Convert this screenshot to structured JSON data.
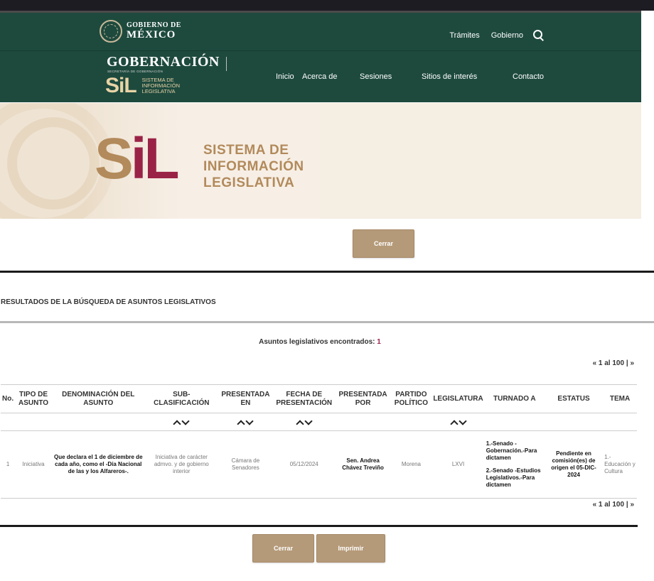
{
  "gov": {
    "logo_line1": "GOBIERNO DE",
    "logo_line2": "MÉXICO",
    "nav": [
      "Trámites",
      "Gobierno"
    ]
  },
  "sil_header": {
    "gobernacion": "GOBERNACIÓN",
    "gobernacion_sub": "SECRETARÍA DE GOBERNACIÓN",
    "sil_letters": "SiL",
    "sil_label_lines": [
      "SISTEMA DE",
      "INFORMACIÓN",
      "LEGISLATIVA"
    ],
    "nav": [
      "Inicio",
      "Acerca de",
      "Sesiones",
      "Sitios de interés",
      "Contacto"
    ]
  },
  "banner": {
    "sil_s": "S",
    "sil_i": "i",
    "sil_l": "L",
    "label_lines": [
      "SISTEMA DE",
      "INFORMACIÓN",
      "LEGISLATIVA"
    ]
  },
  "buttons": {
    "close_top": "Cerrar",
    "close_bottom": "Cerrar",
    "print": "Imprimir"
  },
  "results": {
    "title": "RESULTADOS DE LA BÚSQUEDA DE ASUNTOS LEGISLATIVOS",
    "found_label": "Asuntos legislativos encontrados:",
    "found_count": "1",
    "pager": {
      "prev": "«",
      "range": "1 al 100",
      "sep": "|",
      "next": "»"
    },
    "columns": [
      "No.",
      "TIPO DE ASUNTO",
      "DENOMINACIÓN DEL ASUNTO",
      "SUB-CLASIFICACIÓN",
      "PRESENTADA EN",
      "FECHA DE PRESENTACIÓN",
      "PRESENTADA POR",
      "PARTIDO POLÍTICO",
      "LEGISLATURA",
      "TURNADO A",
      "ESTATUS",
      "TEMA"
    ],
    "rows": [
      {
        "no": "1",
        "tipo": "Iniciativa",
        "denominacion": "Que declara el 1 de diciembre de cada año, como el -Día Nacional de las y los Alfareros-.",
        "subclasificacion": "Iniciativa de carácter admvo. y de gobierno interior",
        "presentada_en": "Cámara de Senadores",
        "fecha": "05/12/2024",
        "presentada_por": "Sen. Andrea Chávez Treviño",
        "partido": "Morena",
        "legislatura": "LXVI",
        "turnado": [
          "1.-Senado -Gobernación.-Para dictamen",
          "2.-Senado -Estudios Legislativos.-Para dictamen"
        ],
        "estatus": "Pendiente en comisión(es) de origen el 05-DIC-2024",
        "tema": "1.-Educación y Cultura"
      }
    ]
  },
  "colors": {
    "gov_green": "#1e4a3e",
    "sil_gold": "#b28a5b",
    "sil_wine": "#9b2247",
    "button": "#b59a79"
  }
}
